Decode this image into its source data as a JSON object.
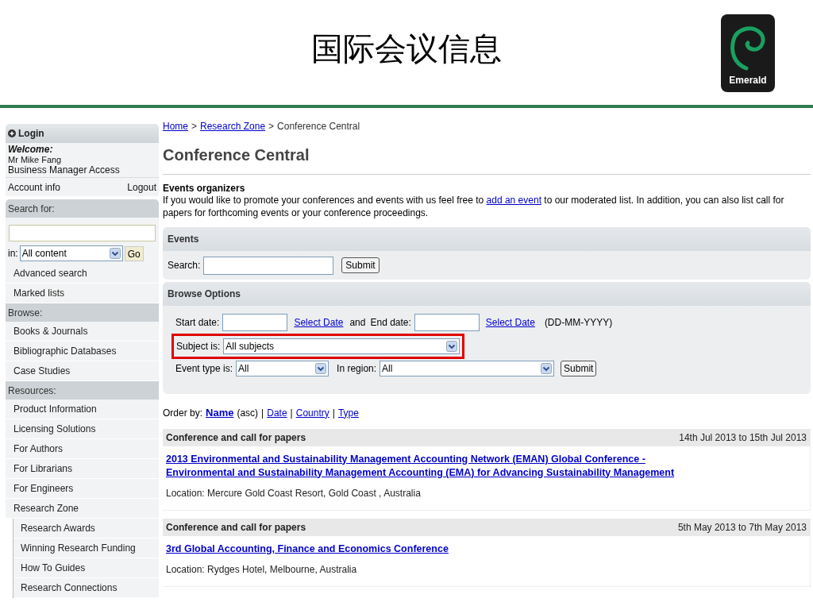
{
  "slide": {
    "title": "国际会议信息",
    "logo_text": "Emerald"
  },
  "sidebar": {
    "login": {
      "title": "Login",
      "welcome": "Welcome:",
      "name": "Mr Mike Fang",
      "access": "Business Manager Access",
      "account": "Account info",
      "logout": "Logout"
    },
    "search": {
      "heading": "Search for:",
      "scope_label": "in:",
      "scope_value": "All content",
      "go": "Go",
      "links": [
        "Advanced search",
        "Marked lists"
      ]
    },
    "browse": {
      "heading": "Browse:",
      "items": [
        {
          "label": "Books & Journals"
        },
        {
          "label": "Bibliographic Databases"
        },
        {
          "label": "Case Studies"
        }
      ]
    },
    "resources": {
      "heading": "Resources:",
      "items": [
        {
          "label": "Product Information"
        },
        {
          "label": "Licensing Solutions"
        },
        {
          "label": "For Authors"
        },
        {
          "label": "For Librarians"
        },
        {
          "label": "For Engineers"
        },
        {
          "label": "Research Zone",
          "expanded": true,
          "children": [
            {
              "label": "Research Awards"
            },
            {
              "label": "Winning Research Funding"
            },
            {
              "label": "How To Guides"
            },
            {
              "label": "Research Connections"
            }
          ]
        }
      ]
    }
  },
  "main": {
    "breadcrumb": [
      {
        "kind": "link",
        "text": "Home"
      },
      {
        "kind": "separator",
        "text": ">"
      },
      {
        "kind": "link",
        "text": "Research Zone"
      },
      {
        "kind": "separator",
        "text": ">"
      },
      {
        "kind": "current",
        "text": "Conference Central"
      }
    ],
    "title": "Conference Central",
    "intro": {
      "heading": "Events organizers",
      "before": "If you would like to promote your conferences and events with us feel free to",
      "link": "add an event",
      "after": "to our moderated list. In addition, you can also list call for papers for forthcoming events or your conference proceedings."
    },
    "events_panel": {
      "title": "Events",
      "search_label": "Search:",
      "submit": "Submit"
    },
    "browse_panel": {
      "title": "Browse Options",
      "start_label": "Start date:",
      "start_select": "Select Date",
      "and": "and",
      "end_label": "End date:",
      "end_select": "Select Date",
      "format": "(DD-MM-YYYY)",
      "subject_label": "Subject is:",
      "subject_value": "All subjects",
      "subject_highlighted": true,
      "type_label": "Event type is:",
      "type_value": "All",
      "region_label": "In region:",
      "region_value": "All",
      "submit": "Submit"
    },
    "order": {
      "label": "Order by:",
      "items": [
        {
          "kind": "option",
          "text": "Name",
          "selected": true
        },
        {
          "kind": "text",
          "text": "(asc)"
        },
        {
          "kind": "text",
          "text": "|"
        },
        {
          "kind": "option",
          "text": "Date",
          "selected": false
        },
        {
          "kind": "text",
          "text": "|"
        },
        {
          "kind": "option",
          "text": "Country",
          "selected": false
        },
        {
          "kind": "text",
          "text": "|"
        },
        {
          "kind": "option",
          "text": "Type",
          "selected": false
        }
      ]
    },
    "events": [
      {
        "type": "Conference and call for papers",
        "dates": "14th Jul 2013 to 15th Jul 2013",
        "title": "2013 Environmental and Sustainability Management Accounting Network (EMAN) Global Conference - Environmental and Sustainability Management Accounting (EMA) for Advancing Sustainability Management",
        "location": "Location: Mercure Gold Coast Resort, Gold Coast , Australia"
      },
      {
        "type": "Conference and call for papers",
        "dates": "5th May 2013 to 7th May 2013",
        "title": "3rd Global Accounting, Finance and Economics Conference",
        "location": "Location: Rydges Hotel, Melbourne, Australia"
      }
    ]
  }
}
